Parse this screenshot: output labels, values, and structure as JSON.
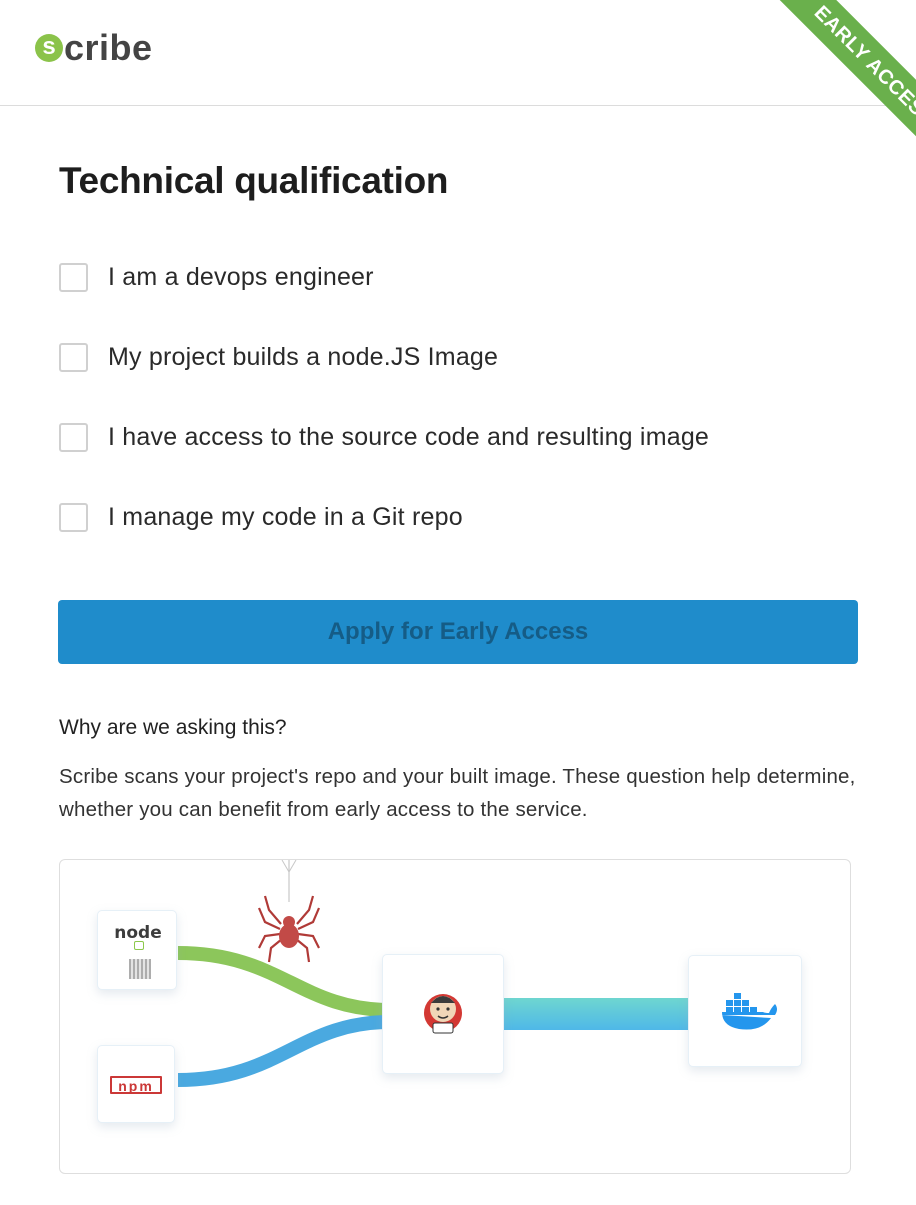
{
  "header": {
    "logo_initial": "s",
    "logo_rest": "cribe",
    "ribbon": "EARLY ACCESS"
  },
  "page": {
    "title": "Technical qualification"
  },
  "checklist": [
    {
      "label": "I am a devops engineer",
      "checked": false
    },
    {
      "label": "My project builds a node.JS Image",
      "checked": false
    },
    {
      "label": "I have access to the source code and resulting image",
      "checked": false
    },
    {
      "label": "I manage my code in a Git repo",
      "checked": false
    }
  ],
  "apply_button": {
    "label": "Apply for Early Access",
    "color": "#1f8ccb",
    "enabled": false
  },
  "why": {
    "title": "Why are we asking this?",
    "text": "Scribe scans your project's repo and your built image. These question help determine, whether you can benefit from early access to the service."
  },
  "diagram": {
    "node_logo_text": "node",
    "npm_logo_text": "npm",
    "icons": [
      "nodejs-logo-icon",
      "npm-logo-icon",
      "spider-icon",
      "jenkins-icon",
      "docker-icon"
    ],
    "colors": {
      "green_pipe": "#8cc65b",
      "blue_pipe": "#4aa9e0",
      "teal_pipe": "#6fd6d0",
      "spider": "#c24a47"
    }
  }
}
